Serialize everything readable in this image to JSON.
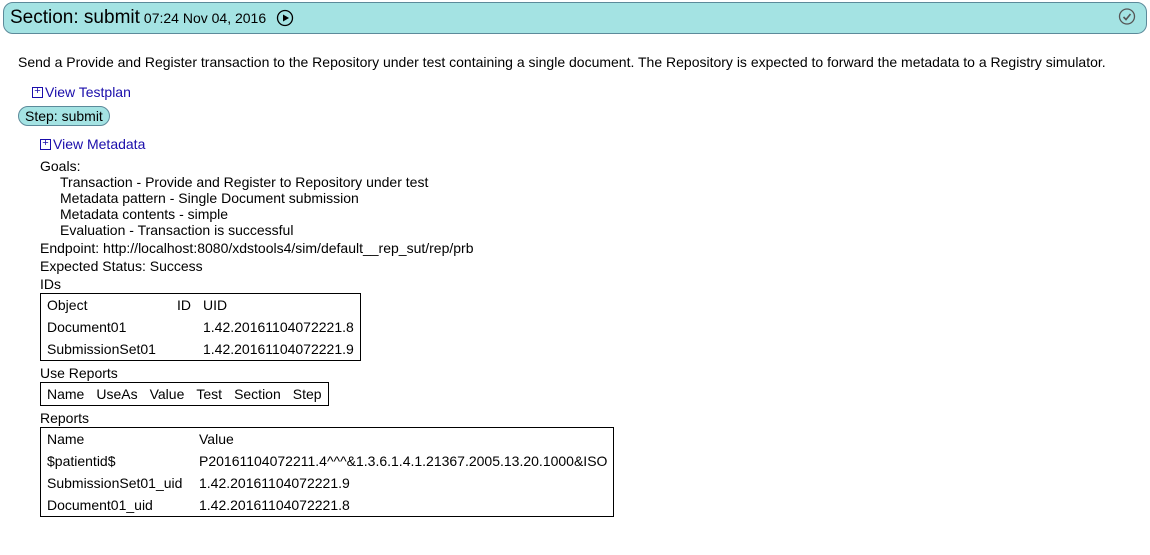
{
  "section": {
    "title": "Section: submit",
    "timestamp": "07:24 Nov 04, 2016"
  },
  "description": "Send a Provide and Register transaction to the Repository under test containing a single document. The Repository is expected to forward the metadata to a Registry simulator.",
  "links": {
    "view_testplan": "View Testplan",
    "view_metadata": "View Metadata"
  },
  "step": {
    "label": "Step: submit"
  },
  "goals": {
    "heading": "Goals:",
    "items": [
      "Transaction - Provide and Register to Repository under test",
      "Metadata pattern - Single Document submission",
      "Metadata contents - simple",
      "Evaluation - Transaction is successful"
    ]
  },
  "endpoint": "Endpoint: http://localhost:8080/xdstools4/sim/default__rep_sut/rep/prb",
  "expected_status": "Expected Status: Success",
  "ids": {
    "heading": "IDs",
    "headers": {
      "object": "Object",
      "id": "ID",
      "uid": "UID"
    },
    "rows": [
      {
        "object": "Document01",
        "id": "",
        "uid": "1.42.20161104072221.8"
      },
      {
        "object": "SubmissionSet01",
        "id": "",
        "uid": "1.42.20161104072221.9"
      }
    ]
  },
  "use_reports": {
    "heading": "Use Reports",
    "headers": {
      "name": "Name",
      "useas": "UseAs",
      "value": "Value",
      "test": "Test",
      "section": "Section",
      "step": "Step"
    }
  },
  "reports": {
    "heading": "Reports",
    "headers": {
      "name": "Name",
      "value": "Value"
    },
    "rows": [
      {
        "name": "$patientid$",
        "value": "P20161104072211.4^^^&1.3.6.1.4.1.21367.2005.13.20.1000&ISO"
      },
      {
        "name": "SubmissionSet01_uid",
        "value": "1.42.20161104072221.9"
      },
      {
        "name": "Document01_uid",
        "value": "1.42.20161104072221.8"
      }
    ]
  }
}
